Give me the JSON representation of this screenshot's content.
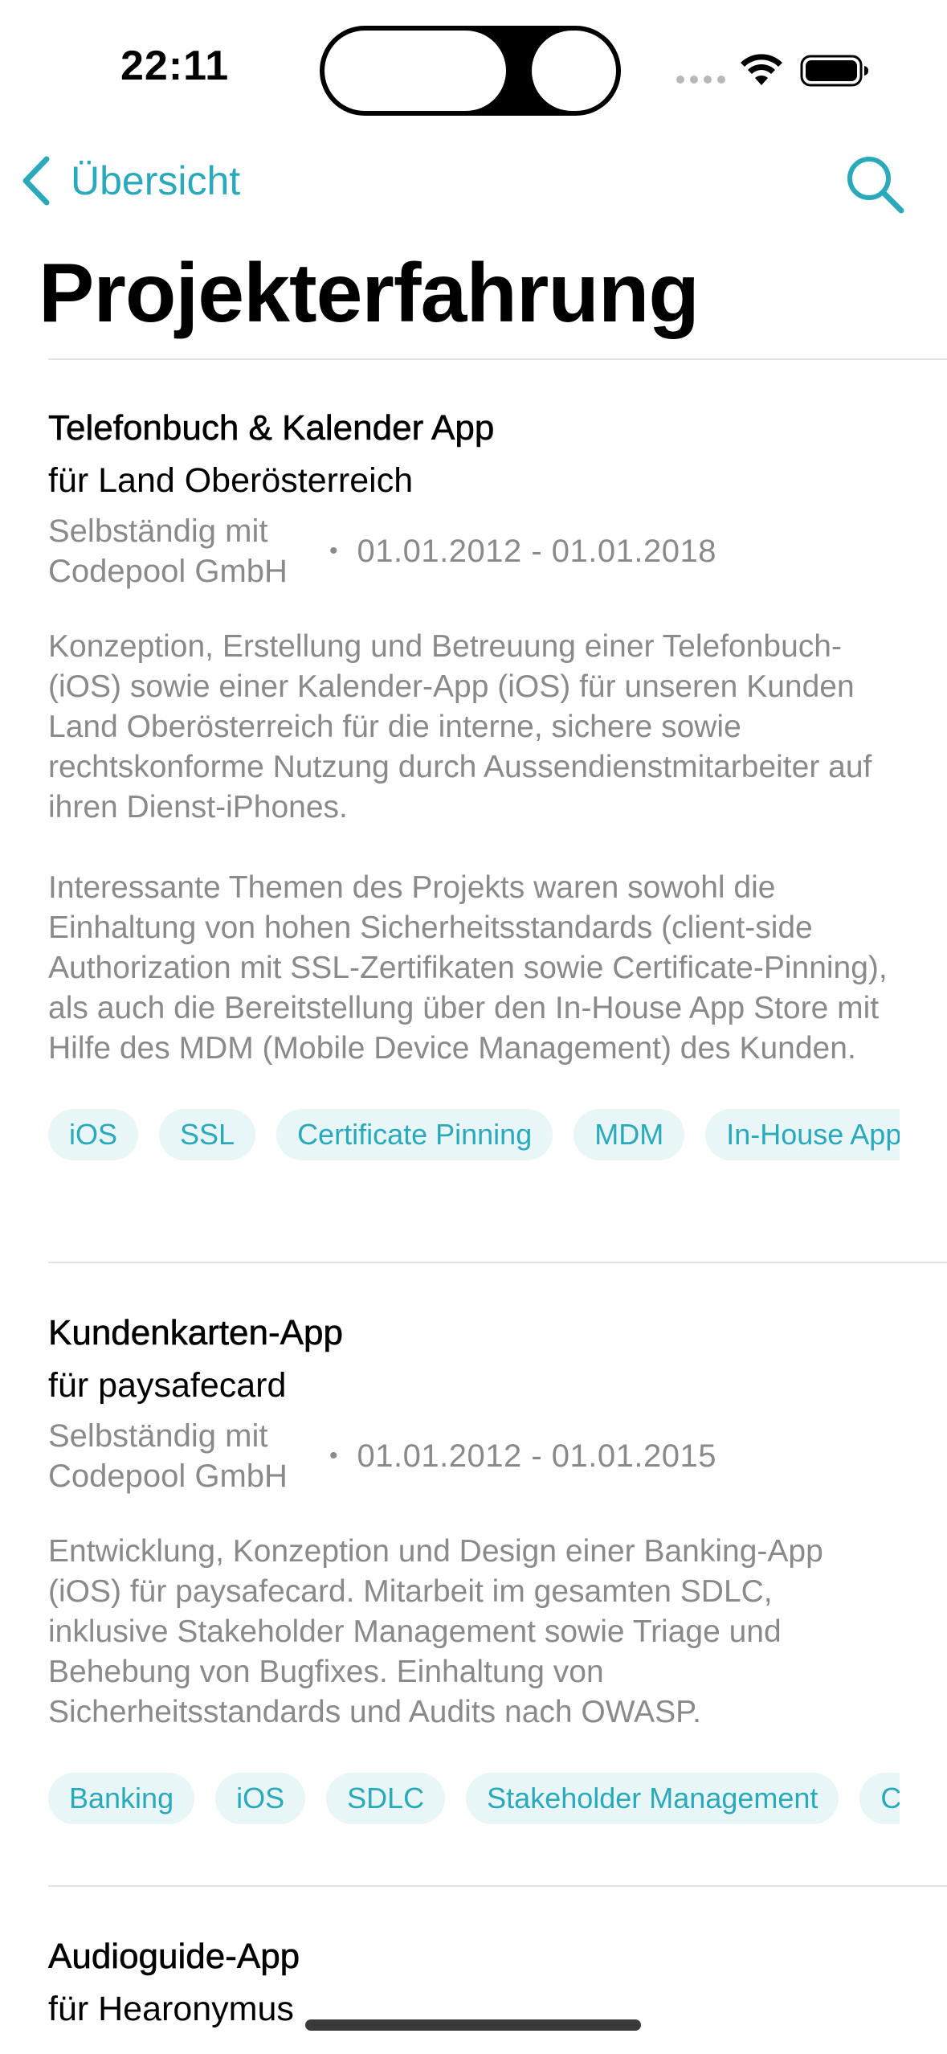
{
  "status_bar": {
    "time": "22:11",
    "wifi_icon": "wifi-icon",
    "battery_icon": "battery-full-icon"
  },
  "nav": {
    "back_label": "Übersicht",
    "back_icon": "chevron-left-icon",
    "search_icon": "magnifying-glass-icon",
    "accent_color": "#2aa9bb"
  },
  "page_title": "Projekterfahrung",
  "projects": [
    {
      "title": "Telefonbuch & Kalender App",
      "client": "für Land Oberösterreich",
      "employer": "Selbständig mit Codepool GmbH",
      "dates": "01.01.2012 - 01.01.2018",
      "paragraphs": [
        "Konzeption, Erstellung und Betreuung einer Telefonbuch- (iOS) sowie einer Kalender-App (iOS) für unseren Kunden Land Oberösterreich für die interne, sichere sowie rechtskonforme Nutzung durch Aussendienstmitarbeiter auf ihren Dienst-iPhones.",
        "Interessante Themen des Projekts waren sowohl die Einhaltung von hohen Sicherheitsstandards (client-side Authorization mit SSL-Zertifikaten sowie Certificate-Pinning), als auch die Bereitstellung über den In-House App Store mit Hilfe des MDM (Mobile Device Management) des Kunden."
      ],
      "tags": [
        "iOS",
        "SSL",
        "Certificate Pinning",
        "MDM",
        "In-House App"
      ]
    },
    {
      "title": "Kundenkarten-App",
      "client": "für paysafecard",
      "employer": "Selbständig mit Codepool GmbH",
      "dates": "01.01.2012 - 01.01.2015",
      "paragraphs": [
        "Entwicklung, Konzeption und Design einer Banking-App (iOS) für paysafecard. Mitarbeit im gesamten SDLC, inklusive Stakeholder Management sowie Triage und Behebung von Bugfixes. Einhaltung von Sicherheitsstandards und Audits nach OWASP."
      ],
      "tags": [
        "Banking",
        "iOS",
        "SDLC",
        "Stakeholder Management",
        "C"
      ]
    },
    {
      "title": "Audioguide-App",
      "client": "für Hearonymus"
    }
  ]
}
